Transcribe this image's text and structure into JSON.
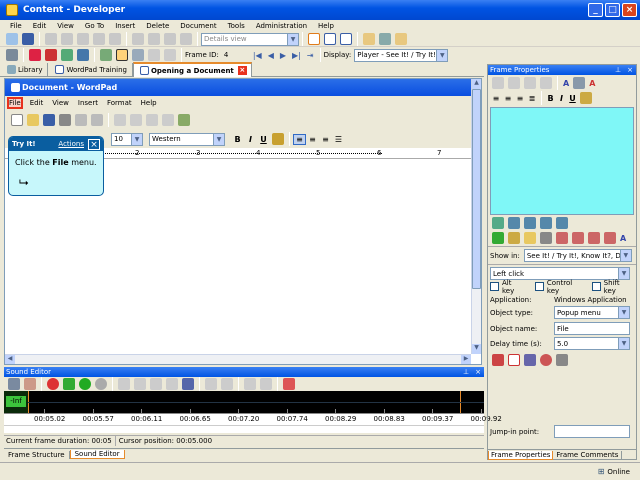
{
  "window": {
    "title": "Content - Developer",
    "min_icon": "minimize-icon",
    "max_icon": "maximize-icon",
    "close_icon": "close-icon"
  },
  "menubar": [
    "File",
    "Edit",
    "View",
    "Go To",
    "Insert",
    "Delete",
    "Document",
    "Tools",
    "Administration",
    "Help"
  ],
  "toolbar1": {
    "view_select": "Details view"
  },
  "toolbar2": {
    "frame_id_label": "Frame ID:",
    "frame_id_value": "4",
    "display_label": "Display:",
    "display_value": "Player - See It! / Try It!"
  },
  "doc_tabs": [
    {
      "label": "Library"
    },
    {
      "label": "WordPad Training"
    },
    {
      "label": "Opening a Document",
      "active": true
    }
  ],
  "wordpad": {
    "title": "Document - WordPad",
    "menu": [
      "File",
      "Edit",
      "View",
      "Insert",
      "Format",
      "Help"
    ],
    "font_size": "10",
    "script": "Western",
    "ruler_numbers": [
      "1",
      "2",
      "3",
      "4",
      "5",
      "6",
      "7"
    ]
  },
  "bubble": {
    "title": "Try It!",
    "actions": "Actions",
    "text_before": "Click the ",
    "text_bold": "File",
    "text_after": " menu."
  },
  "sound_editor": {
    "title": "Sound Editor",
    "level": "-Inf",
    "times": [
      "00:05.02",
      "00:05.57",
      "00:06.11",
      "00:06.65",
      "00:07.20",
      "00:07.74",
      "00:08.29",
      "00:08.83",
      "00:09.37",
      "00:09.92"
    ],
    "status_duration": "Current frame duration: 00:05",
    "status_cursor": "Cursor position: 00:05.000"
  },
  "bottom_tabs": [
    {
      "label": "Frame Structure"
    },
    {
      "label": "Sound Editor",
      "active": true
    }
  ],
  "frame_properties": {
    "title": "Frame Properties",
    "show_in_label": "Show in:",
    "show_in_value": "See It! / Try It!, Know It?, Do It!",
    "action": "Left click",
    "alt": "Alt key",
    "ctrl": "Control key",
    "shift": "Shift key",
    "application_label": "Application:",
    "application_value": "Windows Application",
    "object_type_label": "Object type:",
    "object_type_value": "Popup menu",
    "object_name_label": "Object name:",
    "object_name_value": "File",
    "delay_label": "Delay time (s):",
    "delay_value": "5.0",
    "jump_label": "Jump-in point:",
    "tabs": [
      {
        "label": "Frame Properties",
        "active": true
      },
      {
        "label": "Frame Comments"
      }
    ]
  },
  "status": {
    "online": "Online"
  },
  "colors": {
    "title_blue": "#0a246a",
    "xp_blue": "#245edb",
    "cyan": "#7ff7f7",
    "bubble": "#c7f7fb",
    "red": "#e8321e"
  }
}
